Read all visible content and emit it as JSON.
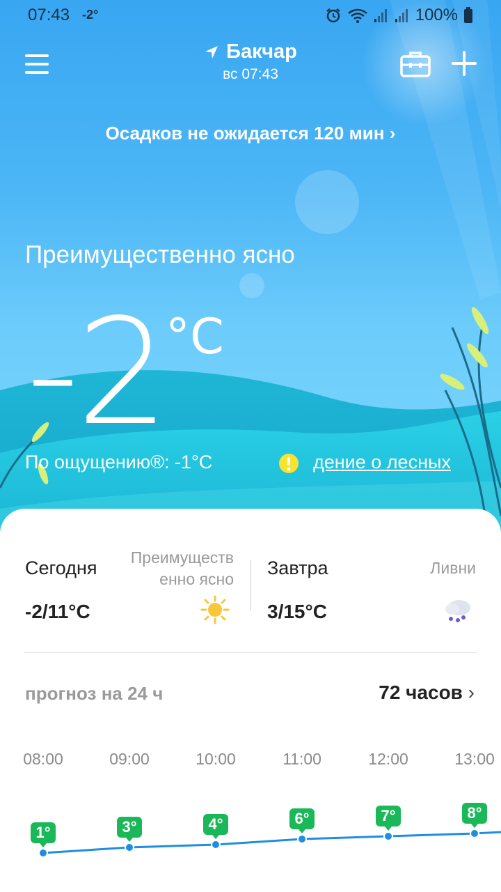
{
  "status_bar": {
    "time": "07:43",
    "temp": "-2°",
    "battery": "100%",
    "icons": [
      "alarm-icon",
      "wifi-icon",
      "signal-icon",
      "battery-icon"
    ]
  },
  "header": {
    "city": "Бакчар",
    "date": "вс  07:43"
  },
  "precip_notice": "Осадков не ожидается 120 мин",
  "current": {
    "condition": "Преимущественно ясно",
    "temperature": "-2",
    "unit": "°C",
    "feels_like": "По ощущению®: -1°C",
    "alert": "дение о лесных"
  },
  "daily": {
    "today": {
      "label": "Сегодня",
      "temp": "-2/11°C",
      "condition": "Преимуществ енно ясно",
      "icon": "sun-icon"
    },
    "tomorrow": {
      "label": "Завтра",
      "temp": "3/15°C",
      "condition": "Ливни",
      "icon": "rain-cloud-icon"
    }
  },
  "forecast": {
    "title": "прогноз на 24 ч",
    "link": "72 часов",
    "hours": [
      "08:00",
      "09:00",
      "10:00",
      "11:00",
      "12:00",
      "13:00"
    ],
    "temps": [
      "1°",
      "3°",
      "4°",
      "6°",
      "7°",
      "8°"
    ],
    "values": [
      1,
      3,
      4,
      6,
      7,
      8
    ]
  },
  "colors": {
    "accent_green": "#1bb85a",
    "line_blue": "#1f8ee0",
    "sky_top": "#38a6f1"
  }
}
